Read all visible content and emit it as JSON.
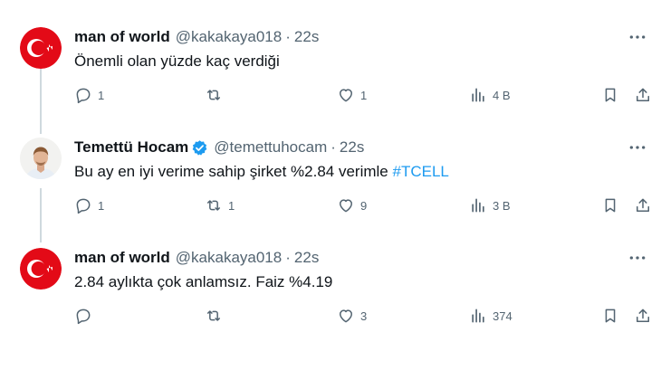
{
  "tweets": [
    {
      "name": "man of world",
      "handle": "@kakakaya018",
      "time": "22s",
      "text": "Önemli olan yüzde kaç verdiği",
      "hashtag": "",
      "avatar_icon": "turkey-flag-icon",
      "verified": false,
      "replies": "1",
      "retweets": "",
      "likes": "1",
      "views": "4 B"
    },
    {
      "name": "Temettü Hocam",
      "handle": "@temettuhocam",
      "time": "22s",
      "text": "Bu ay en iyi verime sahip şirket %2.84 verimle ",
      "hashtag": "#TCELL",
      "avatar_icon": "person-photo-icon",
      "verified": true,
      "replies": "1",
      "retweets": "1",
      "likes": "9",
      "views": "3 B"
    },
    {
      "name": "man of world",
      "handle": "@kakakaya018",
      "time": "22s",
      "text": "2.84 aylıkta çok anlamsız. Faiz %4.19",
      "hashtag": "",
      "avatar_icon": "turkey-flag-icon",
      "verified": false,
      "replies": "",
      "retweets": "",
      "likes": "3",
      "views": "374"
    }
  ],
  "separator": "·",
  "colors": {
    "accent": "#1d9bf0",
    "muted": "#536471",
    "text": "#0f1419",
    "flag_red": "#e30a17"
  }
}
